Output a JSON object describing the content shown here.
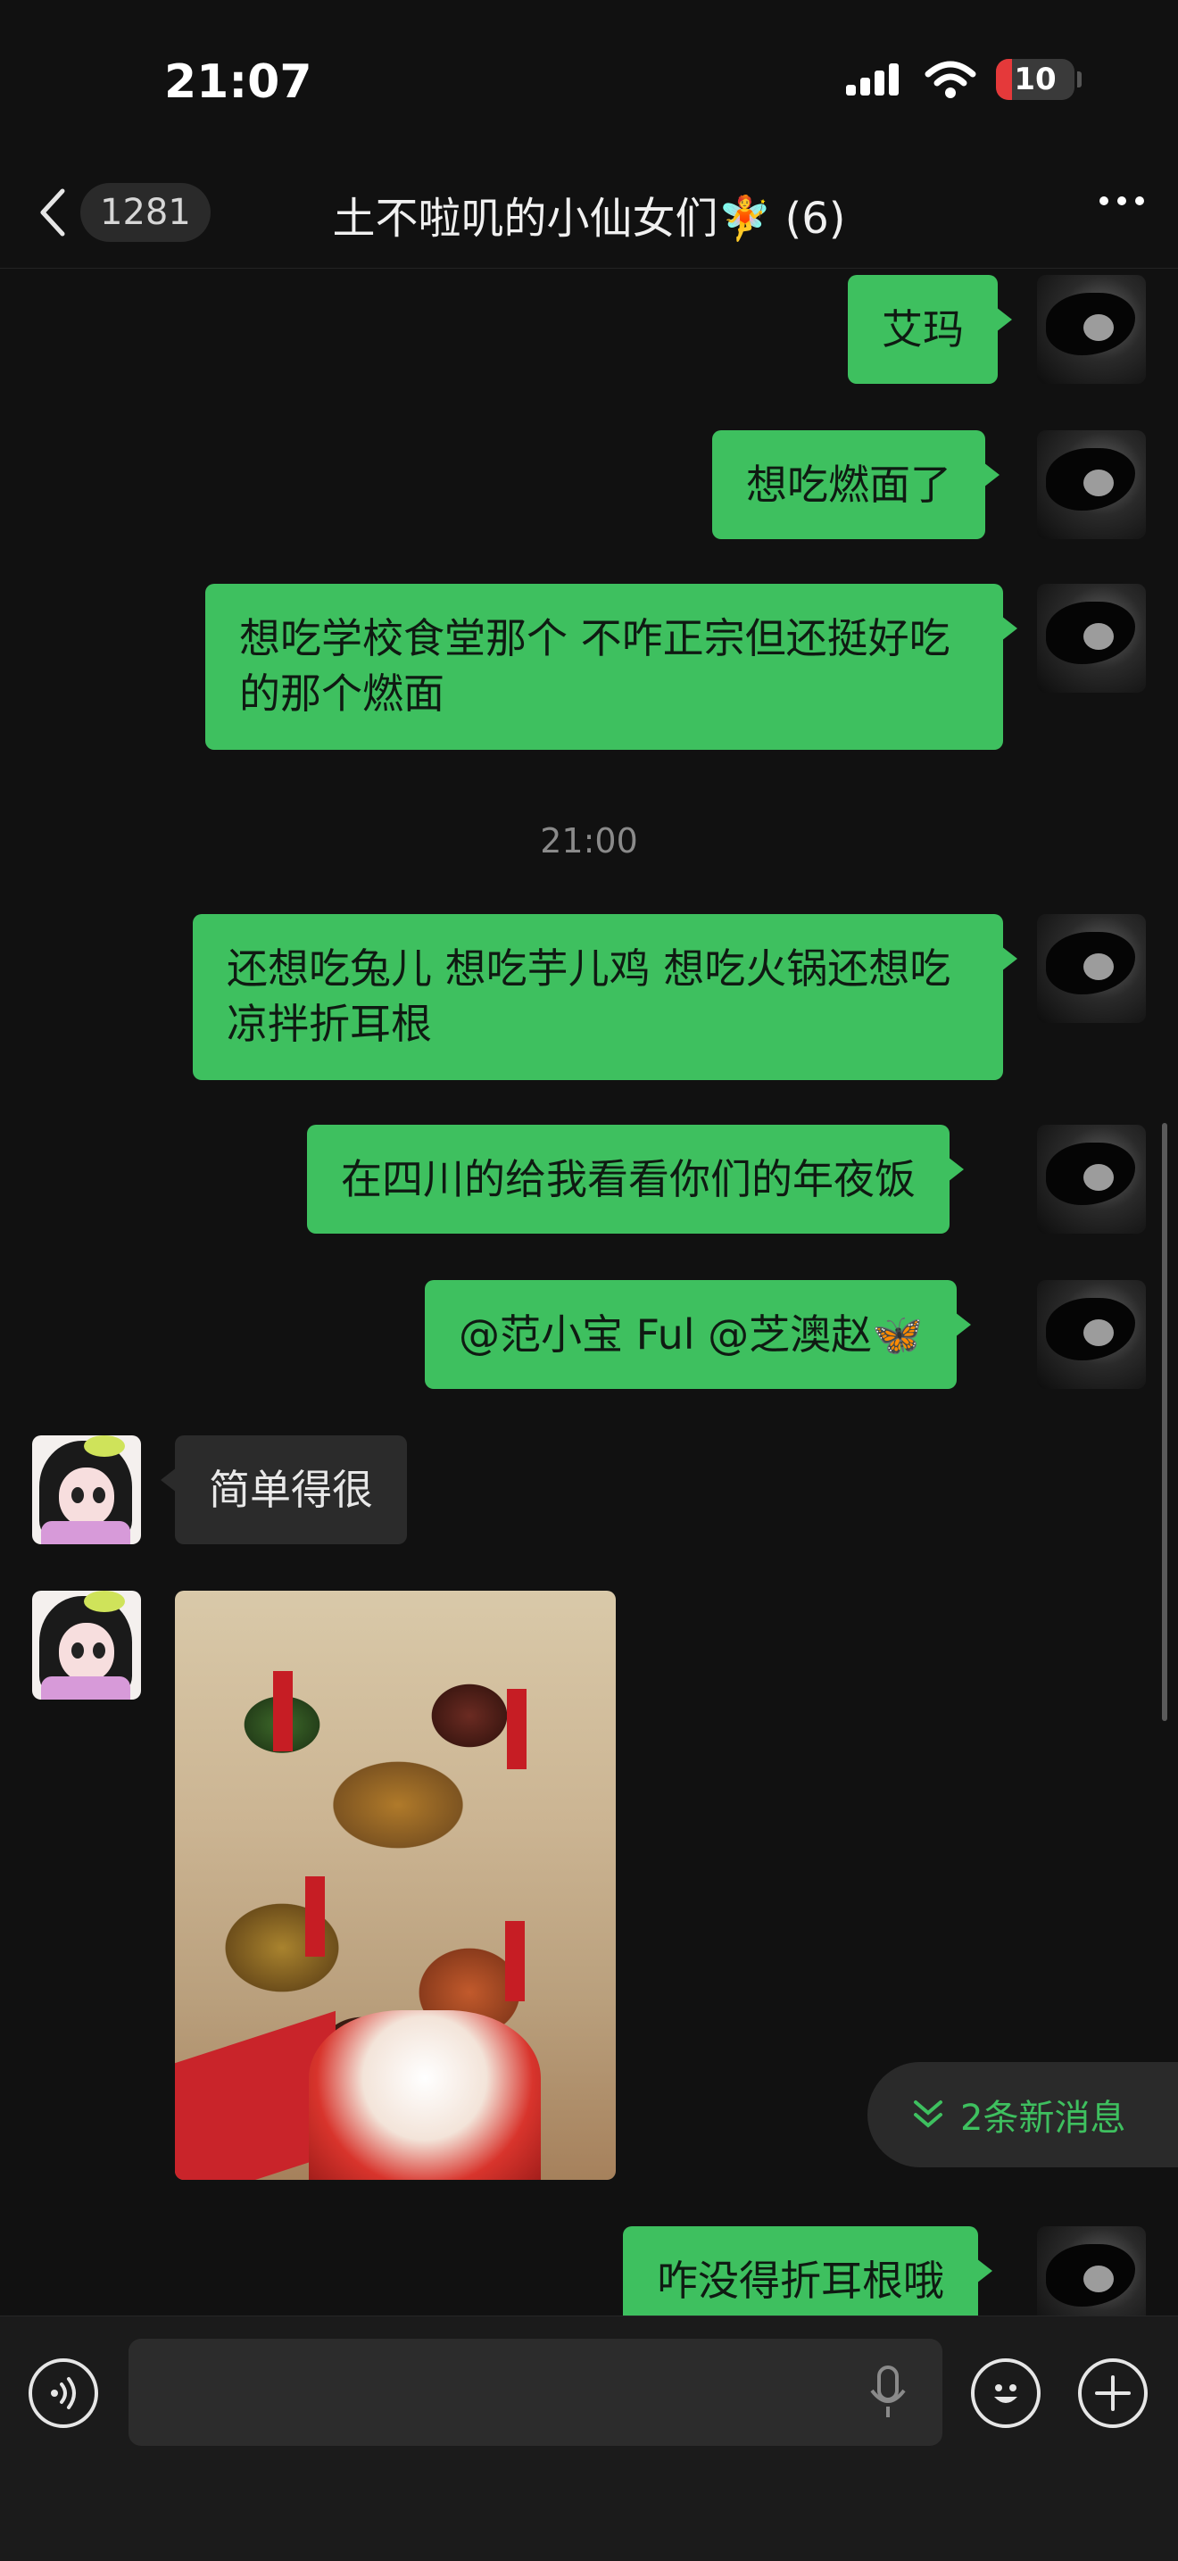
{
  "status_bar": {
    "time": "21:07",
    "battery": "10"
  },
  "nav": {
    "back_count": "1281",
    "title": "土不啦叽的小仙女们🧚 (6)"
  },
  "messages": [
    {
      "text": "艾玛"
    },
    {
      "text": "想吃燃面了"
    },
    {
      "text": "想吃学校食堂那个 不咋正宗但还挺好吃的那个燃面"
    },
    {
      "text": "还想吃兔儿 想吃芋儿鸡 想吃火锅还想吃凉拌折耳根"
    },
    {
      "text": "在四川的给我看看你们的年夜饭"
    },
    {
      "text": "@范小宝 Ful @芝澳赵🦋"
    },
    {
      "text": "简单得很"
    },
    {
      "text": "咋没得折耳根哦"
    }
  ],
  "timestamp": "21:00",
  "new_messages": "2条新消息",
  "colors": {
    "bubble_self": "#3ec05f",
    "bubble_other": "#2b2b2b",
    "background": "#111111",
    "accent": "#3ec05f"
  },
  "icons": [
    "back-icon",
    "signal-icon",
    "wifi-icon",
    "battery-icon",
    "more-icon",
    "voice-icon",
    "mic-icon",
    "emoji-icon",
    "plus-icon",
    "double-chevron-down-icon"
  ]
}
